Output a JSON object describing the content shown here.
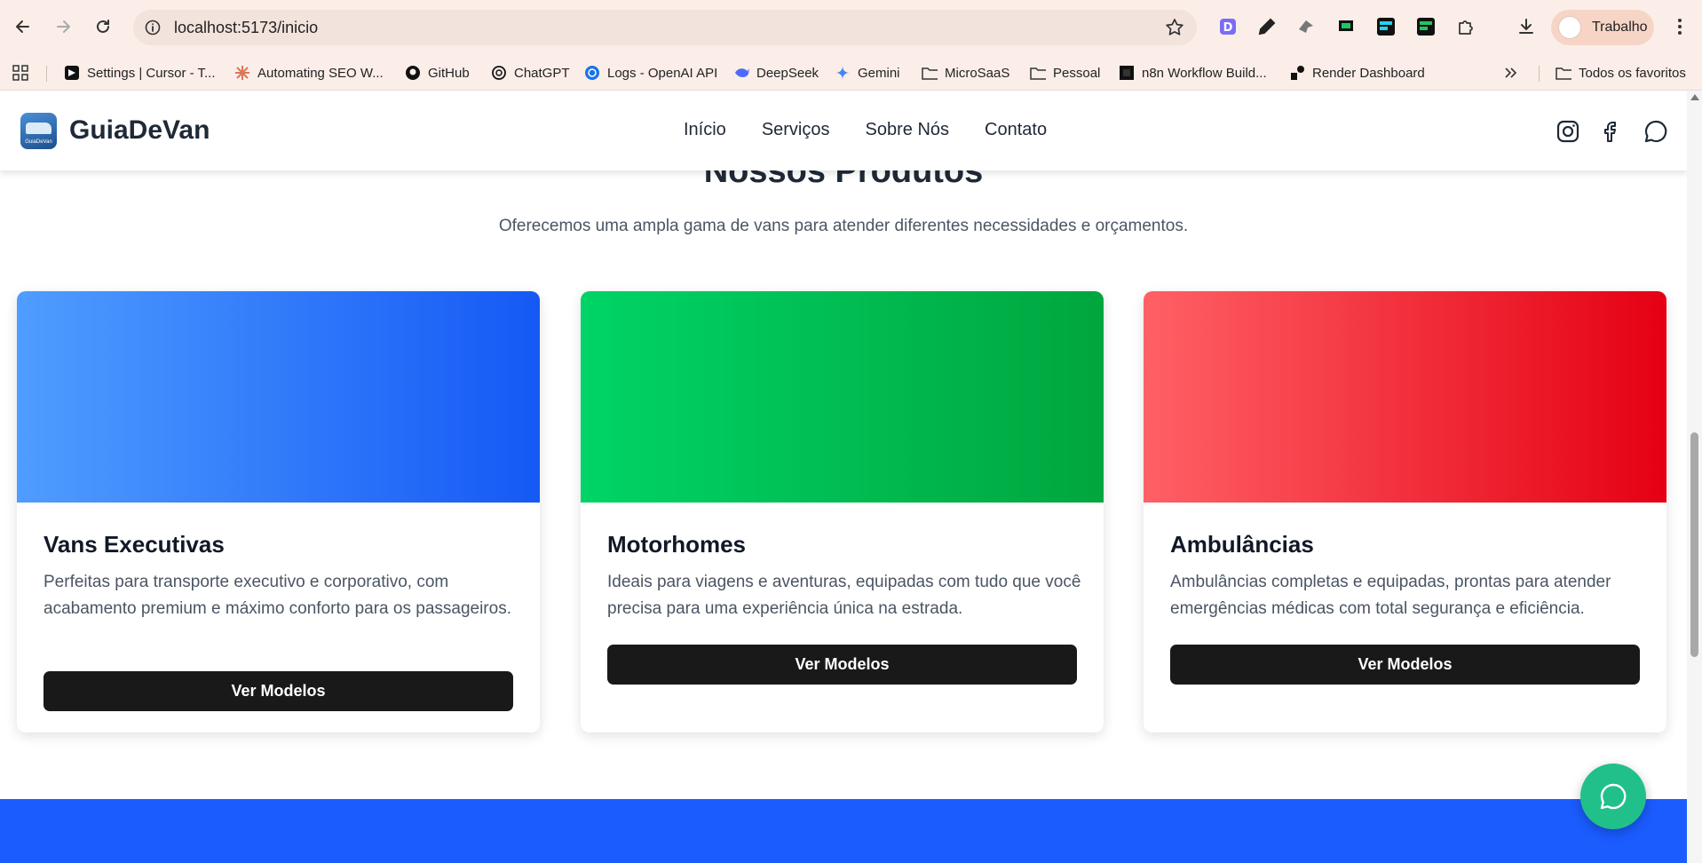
{
  "browser": {
    "url": "localhost:5173/inicio",
    "profile_label": "Trabalho",
    "bookmarks": [
      {
        "label": "Settings | Cursor - T...",
        "icon": "cursor-icon"
      },
      {
        "label": "Automating SEO W...",
        "icon": "claude-icon"
      },
      {
        "label": "GitHub",
        "icon": "github-icon"
      },
      {
        "label": "ChatGPT",
        "icon": "chatgpt-icon"
      },
      {
        "label": "Logs - OpenAI API",
        "icon": "openai-icon"
      },
      {
        "label": "DeepSeek",
        "icon": "deepseek-icon"
      },
      {
        "label": "Gemini",
        "icon": "gemini-icon"
      },
      {
        "label": "MicroSaaS",
        "icon": "folder-icon"
      },
      {
        "label": "Pessoal",
        "icon": "folder-icon"
      },
      {
        "label": "n8n Workflow Build...",
        "icon": "n8n-icon"
      },
      {
        "label": "Render Dashboard",
        "icon": "render-icon"
      }
    ],
    "all_bookmarks_label": "Todos os favoritos"
  },
  "site": {
    "brand": "GuiaDeVan",
    "logo_text": "GuiaDeVan",
    "nav": [
      "Início",
      "Serviços",
      "Sobre Nós",
      "Contato"
    ]
  },
  "products": {
    "title": "Nossos Produtos",
    "subtitle": "Oferecemos uma ampla gama de vans para atender diferentes necessidades e orçamentos.",
    "cards": [
      {
        "title": "Vans Executivas",
        "description": "Perfeitas para transporte executivo e corporativo, com acabamento premium e máximo conforto para os passageiros.",
        "button": "Ver Modelos",
        "gradient": [
          "#4f9dff",
          "#1559f5"
        ]
      },
      {
        "title": "Motorhomes",
        "description": "Ideais para viagens e aventuras, equipadas com tudo que você precisa para uma experiência única na estrada.",
        "button": "Ver Modelos",
        "gradient": [
          "#00d466",
          "#00a63e"
        ]
      },
      {
        "title": "Ambulâncias",
        "description": "Ambulâncias completas e equipadas, prontas para atender emergências médicas com total segurança e eficiência.",
        "button": "Ver Modelos",
        "gradient": [
          "#ff6066",
          "#e50013"
        ]
      }
    ]
  },
  "colors": {
    "chrome_bg": "#fbeee8",
    "band_blue": "#1b5cff",
    "chat_green": "#21c08b",
    "button_dark": "#191919"
  }
}
